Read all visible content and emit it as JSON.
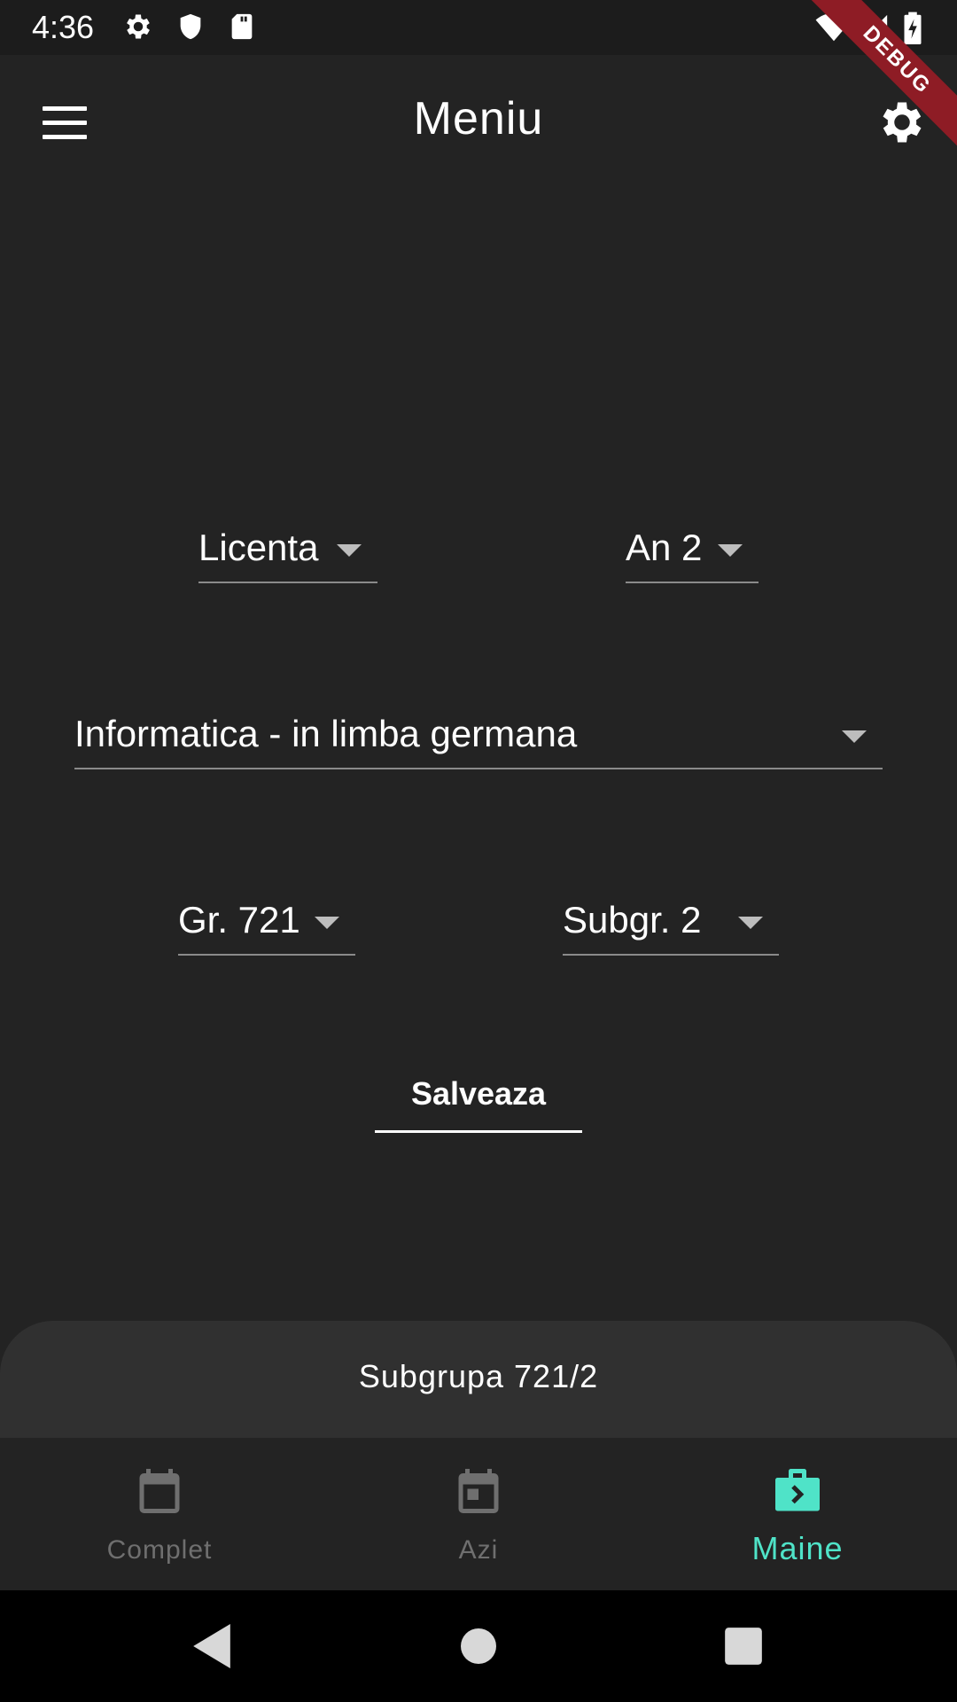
{
  "status_bar": {
    "time": "4:36",
    "icons": [
      "gear-icon",
      "shield-icon",
      "sd-card-icon",
      "wifi-icon",
      "cell-signal-icon",
      "battery-charging-icon"
    ]
  },
  "debug_banner": "DEBUG",
  "app_bar": {
    "title": "Meniu",
    "left_icon": "menu-icon",
    "right_icon": "settings-icon"
  },
  "form": {
    "level": "Licenta",
    "year": "An 2",
    "specialization": "Informatica - in limba germana",
    "group": "Gr. 721",
    "subgroup": "Subgr. 2",
    "save_label": "Salveaza"
  },
  "bottom_sheet": {
    "text": "Subgrupa 721/2"
  },
  "bottom_nav": {
    "items": [
      {
        "label": "Complet",
        "icon": "calendar-icon",
        "active": false
      },
      {
        "label": "Azi",
        "icon": "calendar-today-icon",
        "active": false
      },
      {
        "label": "Maine",
        "icon": "briefcase-arrow-icon",
        "active": true
      }
    ]
  },
  "colors": {
    "background": "#232323",
    "accent": "#4fe3c8",
    "inactive": "#6f6f6f",
    "debug": "#8e1c25"
  },
  "system_nav": [
    "back-icon",
    "home-icon",
    "recents-icon"
  ]
}
